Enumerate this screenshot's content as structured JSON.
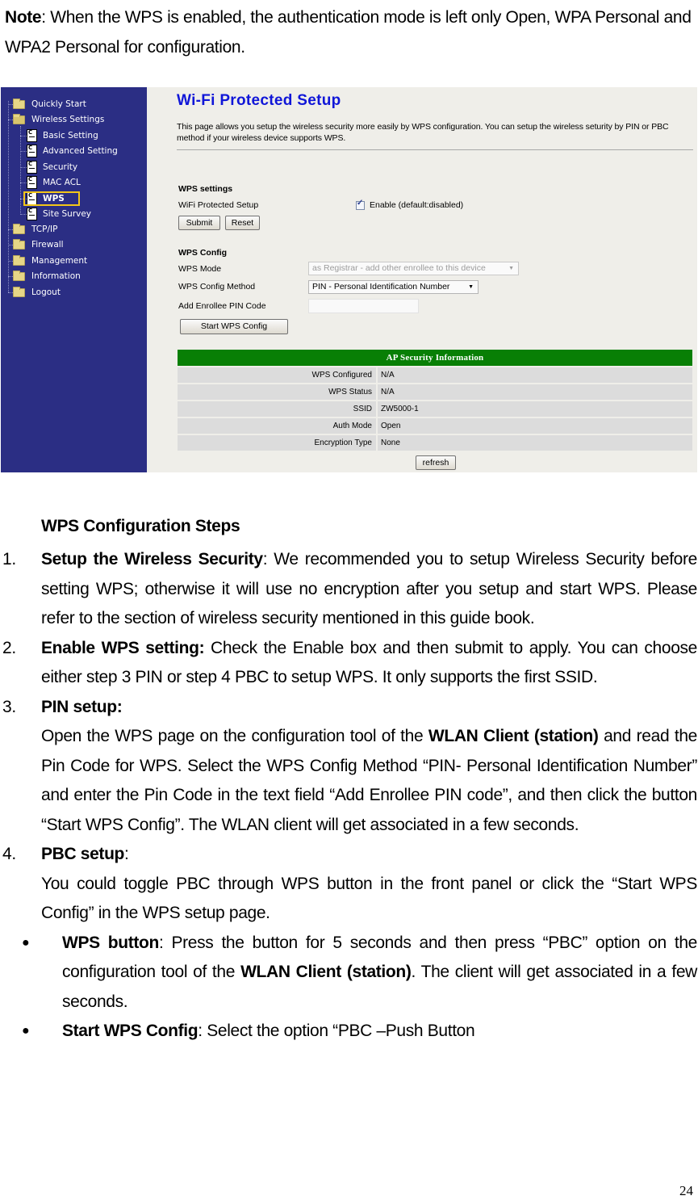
{
  "note": {
    "label": "Note",
    "text": ": When the WPS is enabled, the authentication mode is left only Open, WPA Personal and WPA2 Personal for configuration."
  },
  "figure": {
    "sidebar": {
      "items": [
        {
          "label": "Quickly Start",
          "icon": "folder-icon"
        },
        {
          "label": "Wireless Settings",
          "icon": "folder-open-icon"
        },
        {
          "label": "Basic Setting",
          "icon": "page-icon"
        },
        {
          "label": "Advanced Setting",
          "icon": "page-icon"
        },
        {
          "label": "Security",
          "icon": "page-icon"
        },
        {
          "label": "MAC ACL",
          "icon": "page-icon"
        },
        {
          "label": "WPS",
          "icon": "page-icon",
          "selected": true
        },
        {
          "label": "Site Survey",
          "icon": "page-icon"
        },
        {
          "label": "TCP/IP",
          "icon": "folder-icon"
        },
        {
          "label": "Firewall",
          "icon": "folder-icon"
        },
        {
          "label": "Management",
          "icon": "folder-icon"
        },
        {
          "label": "Information",
          "icon": "folder-icon"
        },
        {
          "label": "Logout",
          "icon": "folder-icon"
        }
      ],
      "page_icon_glyph": "C",
      "background": "#2b2e84",
      "highlight_color": "#f3c619"
    },
    "title": "Wi-Fi Protected Setup",
    "description": "This page allows you setup the wireless security more easily by WPS configuration. You can setup the wireless seturity by PIN or PBC method if your wireless device supports WPS.",
    "wps_settings": {
      "heading": "WPS settings",
      "label": "WiFi Protected Setup",
      "checkbox_label": "Enable (default:disabled)",
      "checked": true,
      "submit_label": "Submit",
      "reset_label": "Reset"
    },
    "wps_config": {
      "heading": "WPS Config",
      "mode_label": "WPS Mode",
      "mode_value": "as Registrar - add other enrollee to this device",
      "method_label": "WPS Config Method",
      "method_value": "PIN - Personal Identification Number",
      "pin_label": "Add Enrollee PIN Code",
      "pin_value": "",
      "start_label": "Start WPS Config",
      "dropdown_glyph": "▼"
    },
    "ap_security": {
      "heading": "AP Security Information",
      "header_color": "#087f05",
      "rows": [
        {
          "key": "WPS Configured",
          "value": "N/A"
        },
        {
          "key": "WPS Status",
          "value": "N/A"
        },
        {
          "key": "SSID",
          "value": "ZW5000-1"
        },
        {
          "key": "Auth Mode",
          "value": "Open"
        },
        {
          "key": "Encryption Type",
          "value": "None"
        }
      ],
      "refresh_label": "refresh"
    }
  },
  "steps": {
    "title": "WPS Configuration Steps",
    "items": [
      {
        "num": "1.",
        "bold": "Setup the Wireless Security",
        "text": ": We recommended you to setup Wireless Security before setting WPS; otherwise it will use no encryption after you setup and start WPS. Please refer to the section of wireless security mentioned in this guide book."
      },
      {
        "num": "2.",
        "bold": "Enable WPS setting:",
        "text": " Check the Enable box and then submit to apply. You can choose either step 3 PIN or step 4 PBC to setup WPS. It only supports the first SSID."
      },
      {
        "num": "3.",
        "bold": "PIN setup:",
        "text": "",
        "body_1": "Open the WPS page on the configuration tool of the ",
        "body_bold": "WLAN Client (station)",
        "body_2": " and read the Pin Code for WPS. Select the WPS Config Method “PIN- Personal Identification Number” and enter the Pin Code in the text field “Add Enrollee PIN code”, and then click the button “Start WPS Config”. The WLAN client will get associated in a few seconds."
      },
      {
        "num": "4.",
        "bold": "PBC setup",
        "text": ":",
        "body": "You could toggle PBC through WPS button in the front panel or click the “Start WPS Config” in the WPS setup page."
      }
    ],
    "bullets": [
      {
        "glyph": "●",
        "bold": "WPS button",
        "text_1": ": Press the button for 5 seconds and then press “PBC” option on the configuration tool of the ",
        "bold_2": "WLAN Client (station)",
        "text_2": ". The client will get associated in a few seconds."
      },
      {
        "glyph": "●",
        "bold": "Start WPS Config",
        "text_1": ": Select the option “PBC –Push Button"
      }
    ]
  },
  "page_number": "24"
}
